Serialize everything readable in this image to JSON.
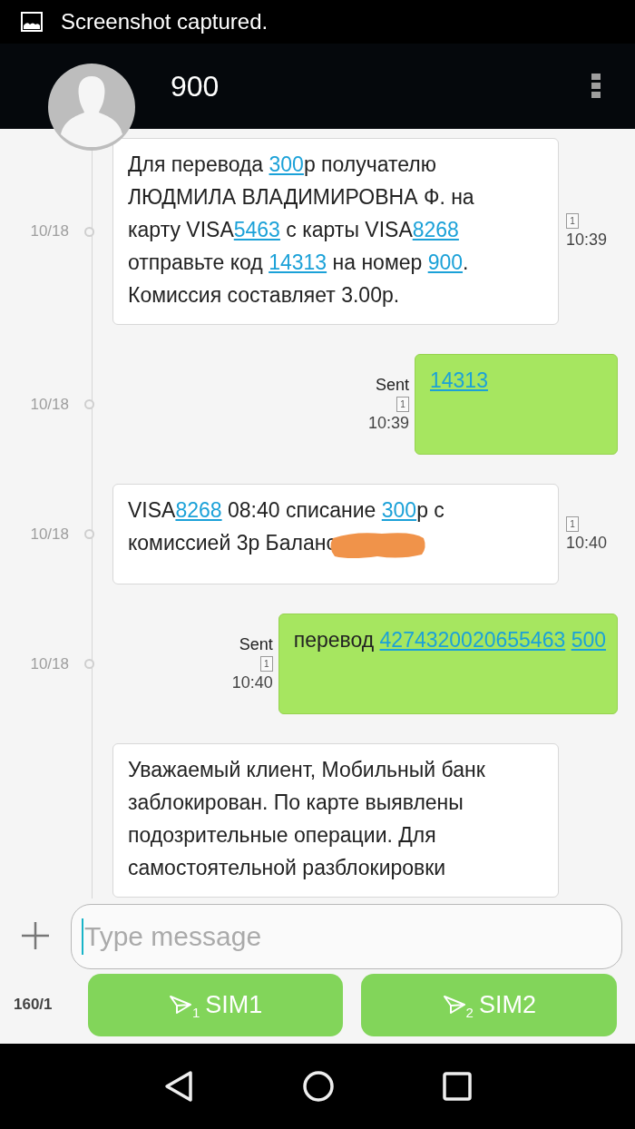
{
  "notification": {
    "text": "Screenshot captured."
  },
  "conversation": {
    "title": "900"
  },
  "messages": [
    {
      "kind": "incoming",
      "date": "10/18",
      "badge": "1",
      "time": "10:39",
      "lines": [
        [
          {
            "kind": "text",
            "t": "Для перевода "
          },
          {
            "kind": "link",
            "t": "300"
          },
          {
            "kind": "text",
            "t": "р получателю"
          }
        ],
        [
          {
            "kind": "text",
            "t": "ЛЮДМИЛА ВЛАДИМИРОВНА Ф. на"
          }
        ],
        [
          {
            "kind": "text",
            "t": "карту VISA"
          },
          {
            "kind": "link",
            "t": "5463"
          },
          {
            "kind": "text",
            "t": " с карты VISA"
          },
          {
            "kind": "link",
            "t": "8268"
          }
        ],
        [
          {
            "kind": "text",
            "t": "отправьте код "
          },
          {
            "kind": "link",
            "t": "14313"
          },
          {
            "kind": "text",
            "t": " на номер "
          },
          {
            "kind": "link",
            "t": "900"
          },
          {
            "kind": "text",
            "t": "."
          }
        ],
        [
          {
            "kind": "text",
            "t": "Комиссия составляет 3.00р."
          }
        ]
      ]
    },
    {
      "kind": "outgoing",
      "date": "10/18",
      "status": "Sent",
      "badge": "1",
      "time": "10:39",
      "lines": [
        [
          {
            "kind": "link",
            "t": "14313"
          }
        ]
      ]
    },
    {
      "kind": "incoming",
      "date": "10/18",
      "badge": "1",
      "time": "10:40",
      "lines": [
        [
          {
            "kind": "text",
            "t": "VISA"
          },
          {
            "kind": "link",
            "t": "8268"
          },
          {
            "kind": "text",
            "t": " 08:40 списание "
          },
          {
            "kind": "link",
            "t": "300"
          },
          {
            "kind": "text",
            "t": "р с"
          }
        ],
        [
          {
            "kind": "text",
            "t": "комиссией 3р Баланс"
          },
          {
            "kind": "redacted"
          }
        ]
      ]
    },
    {
      "kind": "outgoing",
      "date": "10/18",
      "status": "Sent",
      "badge": "1",
      "time": "10:40",
      "lines": [
        [
          {
            "kind": "text",
            "t": "перевод "
          },
          {
            "kind": "link",
            "t": "4274320020655463"
          },
          {
            "kind": "link",
            "t": "500"
          }
        ]
      ]
    },
    {
      "kind": "incoming",
      "lines": [
        [
          {
            "kind": "text",
            "t": "Уважаемый клиент, Мобильный банк"
          }
        ],
        [
          {
            "kind": "text",
            "t": "заблокирован. По карте выявлены"
          }
        ],
        [
          {
            "kind": "text",
            "t": "подозрительные операции. Для"
          }
        ],
        [
          {
            "kind": "text",
            "t": "самостоятельной разблокировки"
          }
        ]
      ]
    }
  ],
  "composer": {
    "placeholder": "Type message",
    "counter": "160/1"
  },
  "send_buttons": [
    {
      "sim": "1",
      "label": "SIM1"
    },
    {
      "sim": "2",
      "label": "SIM2"
    }
  ]
}
